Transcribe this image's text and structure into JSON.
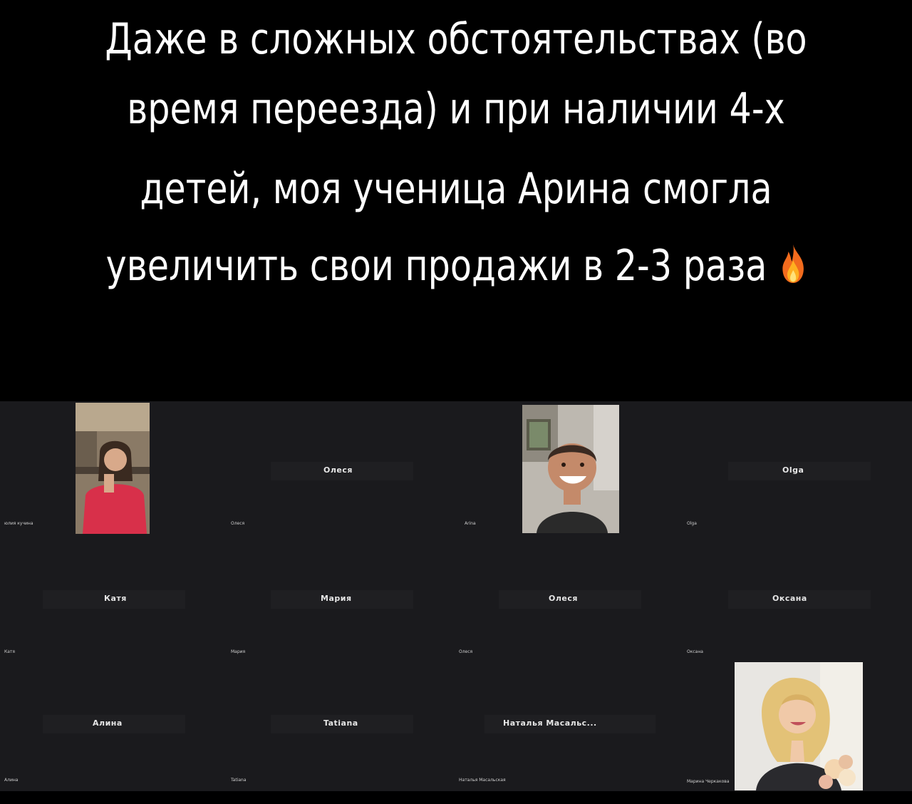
{
  "caption": {
    "lines": [
      "Даже в сложных обстоятельствах (во",
      "время переезда) и при наличии 4-х",
      "детей, моя ученица Арина смогла",
      "увеличить свои продажи в 2-3 раза"
    ],
    "emoji": "fire-emoji"
  },
  "participants": [
    {
      "center": "",
      "small": "юлия кучина",
      "video": true
    },
    {
      "center": "Олеся",
      "small": "Олеся",
      "video": false
    },
    {
      "center": "",
      "small": "Arina",
      "video": true
    },
    {
      "center": "Olga",
      "small": "Olga",
      "video": false
    },
    {
      "center": "Катя",
      "small": "Катя",
      "video": false
    },
    {
      "center": "Мария",
      "small": "Мария",
      "video": false
    },
    {
      "center": "Олеся",
      "small": "Олеся",
      "video": false
    },
    {
      "center": "Оксана",
      "small": "Оксана",
      "video": false
    },
    {
      "center": "Алина",
      "small": "Алина",
      "video": false
    },
    {
      "center": "Tatiana",
      "small": "Tatiana",
      "video": false
    },
    {
      "center": "Наталья Масальс...",
      "small": "Наталья Масальская",
      "video": false
    },
    {
      "center": "",
      "small": "Марина Черкакова",
      "video": true
    }
  ],
  "colors": {
    "background": "#000000",
    "meeting_bg": "#1a1a1d",
    "caption_text": "#ffffff"
  }
}
